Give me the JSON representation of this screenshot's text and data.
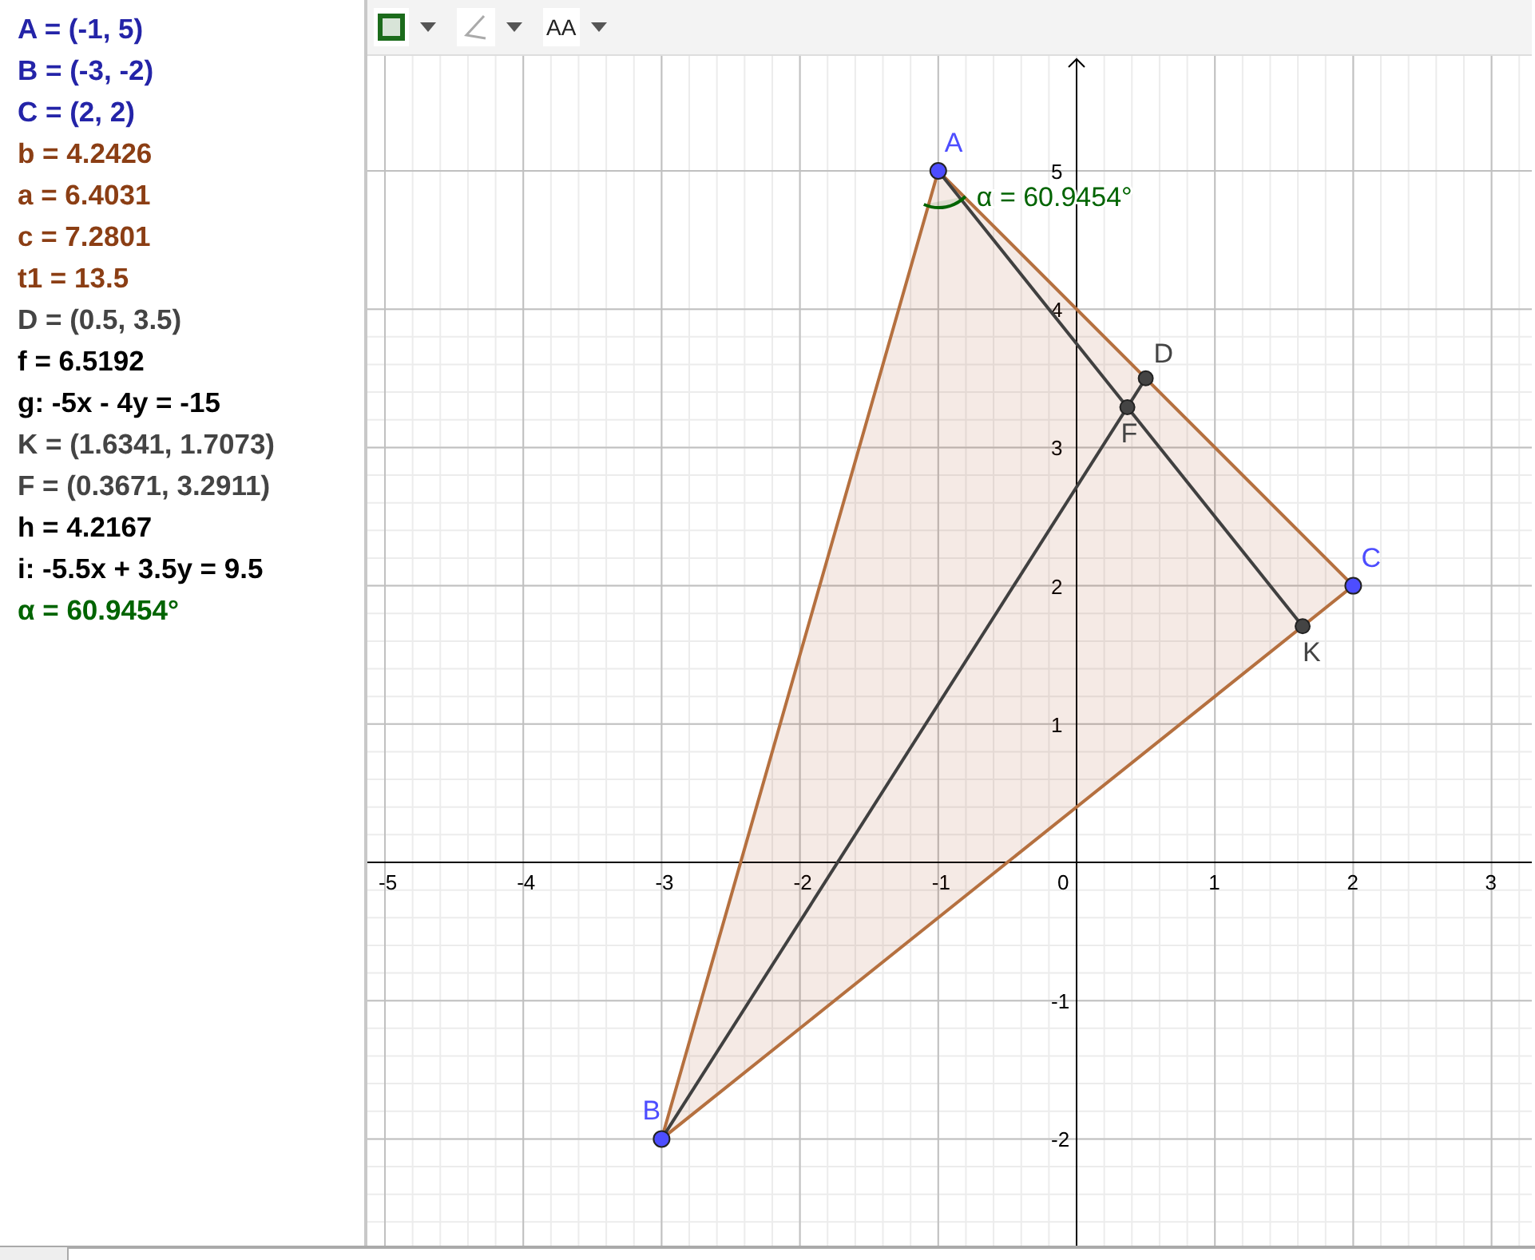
{
  "algebra": [
    {
      "text": "A = (-1, 5)",
      "color": "#2424a8"
    },
    {
      "text": "B = (-3, -2)",
      "color": "#2424a8"
    },
    {
      "text": "C = (2, 2)",
      "color": "#2424a8"
    },
    {
      "text": "b = 4.2426",
      "color": "#8b3e14"
    },
    {
      "text": "a = 6.4031",
      "color": "#8b3e14"
    },
    {
      "text": "c = 7.2801",
      "color": "#8b3e14"
    },
    {
      "text": "t1 = 13.5",
      "color": "#8b3e14"
    },
    {
      "text": "D = (0.5, 3.5)",
      "color": "#444444"
    },
    {
      "text": "f = 6.5192",
      "color": "#000000"
    },
    {
      "text": "g: -5x - 4y = -15",
      "color": "#000000"
    },
    {
      "text": "K = (1.6341, 1.7073)",
      "color": "#444444"
    },
    {
      "text": "F = (0.3671, 3.2911)",
      "color": "#444444"
    },
    {
      "text": "h = 4.2167",
      "color": "#000000"
    },
    {
      "text": "i: -5.5x + 3.5y = 9.5",
      "color": "#000000"
    },
    {
      "text": "α = 60.9454°",
      "color": "#006400"
    }
  ],
  "toolbar": {
    "text_size_label": "AA"
  },
  "graph": {
    "x_ticks": [
      "-5",
      "-4",
      "-3",
      "-2",
      "-1",
      "0",
      "1",
      "2",
      "3"
    ],
    "y_ticks": [
      "5",
      "4",
      "3",
      "2",
      "1",
      "-1",
      "-2"
    ],
    "points": [
      {
        "label": "A",
        "color": "#4d4dff"
      },
      {
        "label": "B",
        "color": "#4d4dff"
      },
      {
        "label": "C",
        "color": "#4d4dff"
      },
      {
        "label": "D",
        "color": "#444444"
      },
      {
        "label": "F",
        "color": "#444444"
      },
      {
        "label": "K",
        "color": "#444444"
      }
    ],
    "angle_label": "α = 60.9454°"
  }
}
